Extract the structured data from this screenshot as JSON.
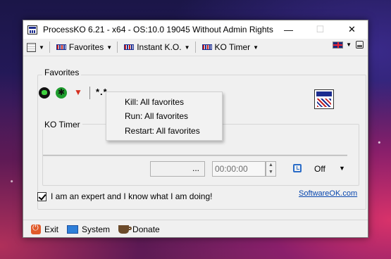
{
  "window": {
    "title": "ProcessKO 6.21 - x64  - OS:10.0 19045 Without Admin Rights",
    "minimize": "—",
    "maximize": "☐",
    "close": "✕"
  },
  "toolbar": {
    "favorites_label": "Favorites",
    "instant_ko_label": "Instant K.O.",
    "ko_timer_label": "KO Timer",
    "caret": "▼"
  },
  "favorites": {
    "group_label": "Favorites",
    "stars": "*.*",
    "context_menu": [
      "Kill: All favorites",
      "Run: All favorites",
      "Restart: All favorites"
    ]
  },
  "ko_timer": {
    "group_label": "KO Timer",
    "path_button": "...",
    "time_value": "00:00:00",
    "spin_up": "▲",
    "spin_down": "▼",
    "mode_value": "Off",
    "mode_caret": "▼"
  },
  "expert": {
    "checkbox_label": "I am an expert and I know what I am doing!",
    "checked": true
  },
  "link": {
    "text": "SoftwareOK.com"
  },
  "footer": {
    "exit_label": "Exit",
    "system_label": "System",
    "donate_label": "Donate"
  }
}
